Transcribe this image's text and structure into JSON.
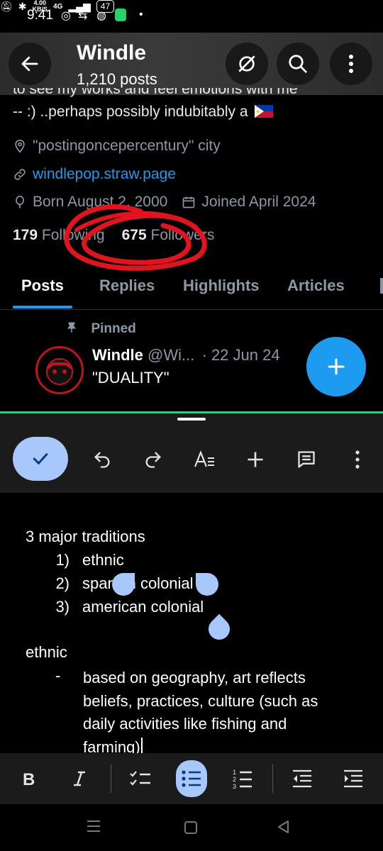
{
  "status_bar": {
    "time": "9:41",
    "speed_value": "4.00",
    "speed_unit": "KB/S",
    "network": "4G",
    "battery": "47"
  },
  "header": {
    "name": "Windle",
    "posts_count": "1,210 posts"
  },
  "profile": {
    "bio_cut_line": "to see my works and feel emotions with me",
    "bio_line": "-- :)  ..perhaps possibly indubitably a",
    "location": "\"postingoncepercentury\" city",
    "website": "windlepop.straw.page",
    "born": "Born August 2, 2000",
    "joined": "Joined April 2024",
    "following_count": "179",
    "following_label": "Following",
    "followers_count": "675",
    "followers_label": "Followers"
  },
  "tabs": [
    "Posts",
    "Replies",
    "Highlights",
    "Articles"
  ],
  "pinned_post": {
    "pinned_label": "Pinned",
    "author": "Windle",
    "handle": "@Wi...",
    "date": "· 22 Jun 24",
    "text": "\"DUALITY\""
  },
  "document": {
    "heading": "3 major traditions",
    "list_numbers": [
      "1)",
      "2)",
      "3)"
    ],
    "list_items": [
      "ethnic",
      "spanish colonial",
      "american colonial"
    ],
    "section": "ethnic",
    "bullet_marker": "-",
    "bullet_lines": [
      "based on geography, art reflects",
      "beliefs, practices, culture (such as",
      "daily activities like fishing and",
      "farming)"
    ]
  },
  "colors": {
    "accent": "#1d9bf0",
    "selection": "#a8c7fa",
    "annotation_red": "#e0141e",
    "divider_green": "#3ec37b"
  }
}
